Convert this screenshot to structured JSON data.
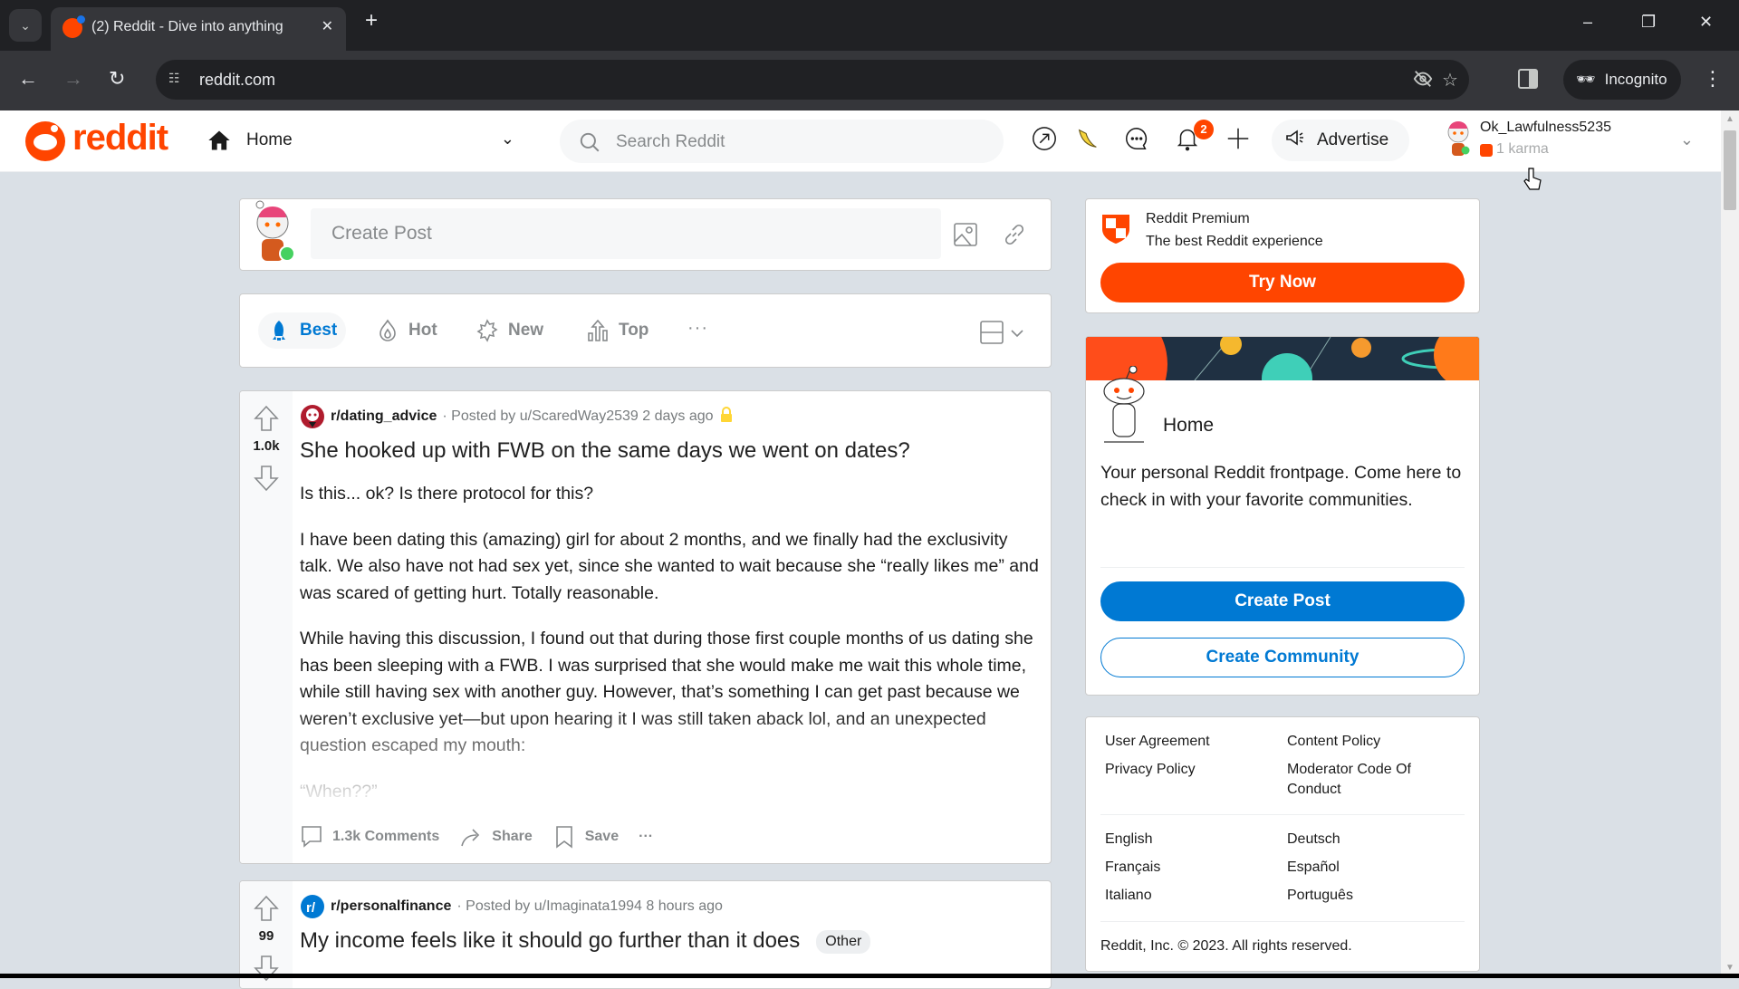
{
  "browser": {
    "tab_title": "(2) Reddit - Dive into anything",
    "url": "reddit.com",
    "incognito_label": "Incognito",
    "window_controls": {
      "minimize": "–",
      "restore": "❐",
      "close": "✕"
    }
  },
  "header": {
    "logo_text": "reddit",
    "feed_selector": "Home",
    "search_placeholder": "Search Reddit",
    "notification_count": "2",
    "advertise_label": "Advertise",
    "user": {
      "name": "Ok_Lawfulness5235",
      "karma": "1 karma"
    },
    "icons": [
      "popular-icon",
      "banana-icon",
      "chat-icon",
      "notifications-icon",
      "create-icon"
    ]
  },
  "create_post": {
    "placeholder": "Create Post"
  },
  "sort": {
    "tabs": [
      {
        "label": "Best",
        "icon": "rocket-icon",
        "active": true
      },
      {
        "label": "Hot",
        "icon": "flame-icon",
        "active": false
      },
      {
        "label": "New",
        "icon": "burst-icon",
        "active": false
      },
      {
        "label": "Top",
        "icon": "bars-up-icon",
        "active": false
      }
    ],
    "more": "···"
  },
  "posts": [
    {
      "subreddit": "r/dating_advice",
      "posted_by": "· Posted by u/ScaredWay2539 2 days ago",
      "score": "1.0k",
      "title": "She hooked up with FWB on the same days we went on dates?",
      "body": [
        "Is this... ok? Is there protocol for this?",
        "I have been dating this (amazing) girl for about 2 months, and we finally had the exclusivity talk. We also have not had sex yet, since she wanted to wait because she “really likes me” and was scared of getting hurt. Totally reasonable.",
        "While having this discussion, I found out that during those first couple months of us dating she has been sleeping with a FWB. I was surprised that she would make me wait this whole time, while still having sex with another guy. However, that’s something I can get past because we weren’t exclusive yet—but upon hearing it I was still taken aback lol, and an unexpected question escaped my mouth:",
        "“When??”"
      ],
      "comments": "1.3k Comments",
      "share": "Share",
      "save": "Save",
      "more": "···"
    },
    {
      "subreddit": "r/personalfinance",
      "posted_by": "· Posted by u/Imaginata1994 8 hours ago",
      "score": "99",
      "title": "My income feels like it should go further than it does",
      "flair": "Other"
    }
  ],
  "premium": {
    "title": "Reddit Premium",
    "subtitle": "The best Reddit experience",
    "button": "Try Now"
  },
  "home_card": {
    "title": "Home",
    "description": "Your personal Reddit frontpage. Come here to check in with your favorite communities.",
    "create_post": "Create Post",
    "create_community": "Create Community"
  },
  "footer": {
    "links": [
      "User Agreement",
      "Content Policy",
      "Privacy Policy",
      "Moderator Code Of Conduct"
    ],
    "languages": [
      "English",
      "Deutsch",
      "Français",
      "Español",
      "Italiano",
      "Português"
    ],
    "copyright": "Reddit, Inc. © 2023. All rights reserved."
  },
  "colors": {
    "brand": "#ff4500",
    "accent": "#0079d3",
    "page_bg": "#dae0e6"
  }
}
